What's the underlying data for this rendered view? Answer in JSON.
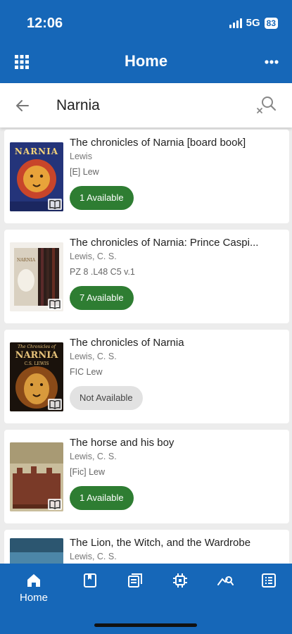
{
  "status": {
    "time": "12:06",
    "network": "5G",
    "battery": "83"
  },
  "header": {
    "title": "Home"
  },
  "search": {
    "value": "Narnia"
  },
  "results": [
    {
      "title": "The chronicles of Narnia [board book]",
      "author": "Lewis",
      "call": "[E] Lew",
      "availability": "1 Available",
      "cover_words": [
        "NARNIA"
      ]
    },
    {
      "title": "The chronicles of Narnia: Prince Caspi...",
      "author": "Lewis, C. S.",
      "call": "PZ 8 .L48 C5 v.1",
      "availability": "7 Available",
      "cover_words": [
        "NARNIA"
      ]
    },
    {
      "title": "The chronicles of Narnia",
      "author": "Lewis, C. S.",
      "call": "FIC Lew",
      "availability": "Not Available",
      "cover_words": [
        "The Chronicles of",
        "NARNIA",
        "C.S. LEWIS"
      ]
    },
    {
      "title": "The horse and his boy",
      "author": "Lewis, C. S.",
      "call": "[Fic] Lew",
      "availability": "1 Available",
      "cover_words": []
    },
    {
      "title": "The Lion, the Witch, and the Wardrobe",
      "author": "Lewis, C. S.",
      "call": "",
      "availability": "",
      "cover_words": []
    }
  ],
  "nav": {
    "home_label": "Home"
  },
  "colors": {
    "primary": "#1667b8",
    "available": "#2e7d32",
    "unavailable": "#e2e2e2"
  }
}
